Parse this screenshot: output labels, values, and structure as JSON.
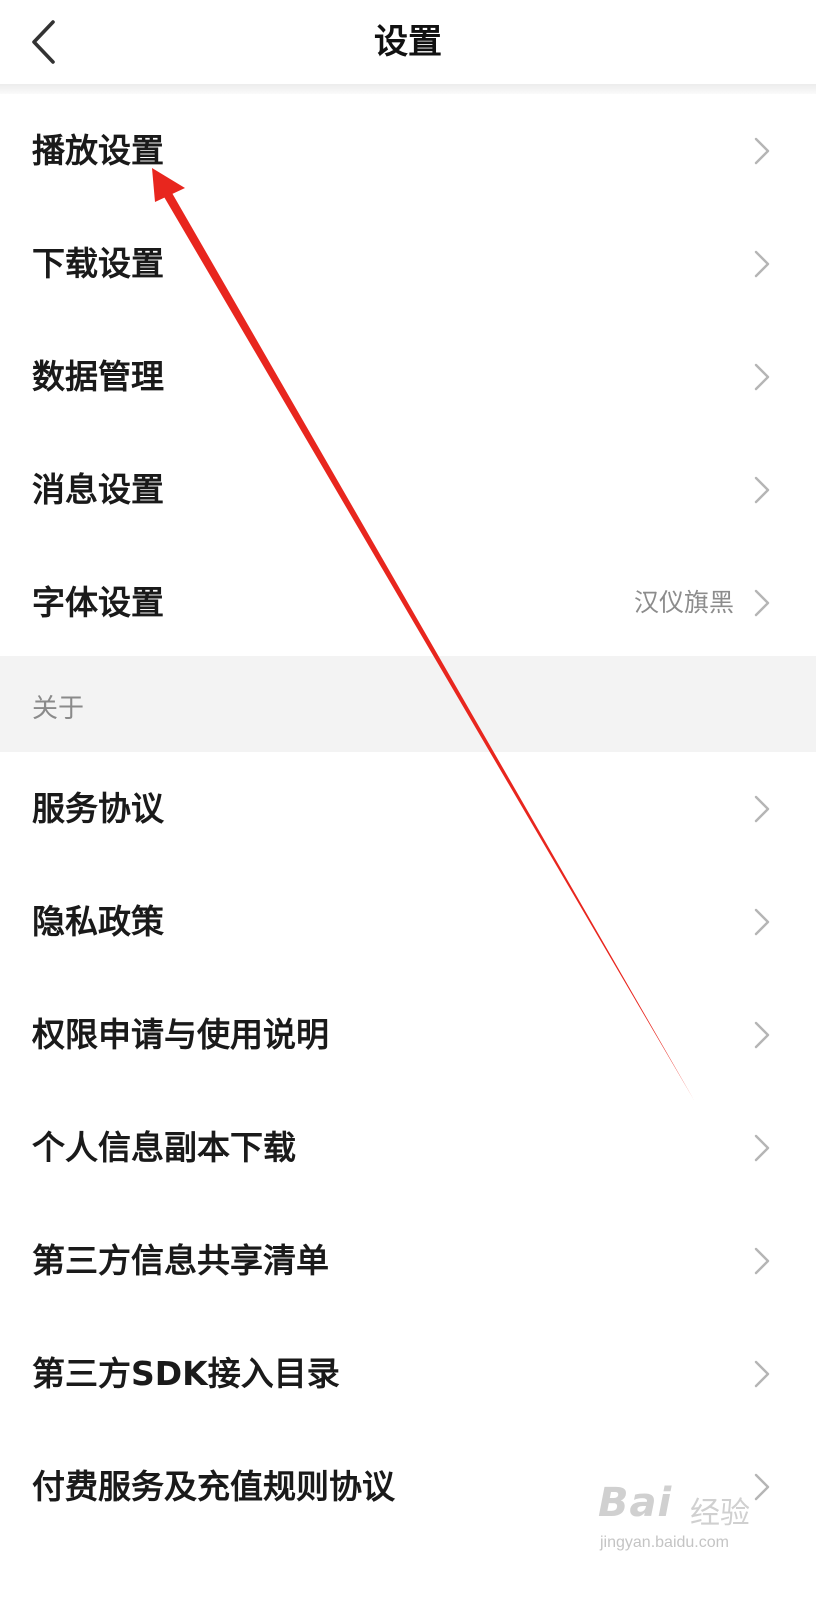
{
  "header": {
    "title": "设置",
    "back_icon": "chevron-left-icon"
  },
  "settings_items": [
    {
      "label": "播放设置"
    },
    {
      "label": "下载设置"
    },
    {
      "label": "数据管理"
    },
    {
      "label": "消息设置"
    },
    {
      "label": "字体设置",
      "value": "汉仪旗黑"
    }
  ],
  "about_section": {
    "title": "关于",
    "items": [
      {
        "label": "服务协议"
      },
      {
        "label": "隐私政策"
      },
      {
        "label": "权限申请与使用说明"
      },
      {
        "label": "个人信息副本下载"
      },
      {
        "label": "第三方信息共享清单"
      },
      {
        "label": "第三方SDK接入目录"
      },
      {
        "label": "付费服务及充值规则协议"
      }
    ]
  },
  "watermark": {
    "brand": "Bai",
    "sub": "经验",
    "url": "jingyan.baidu.com"
  },
  "colors": {
    "annotation_arrow": "#e8261e",
    "section_background": "#f3f3f3",
    "chevron": "#b5b5b5"
  }
}
